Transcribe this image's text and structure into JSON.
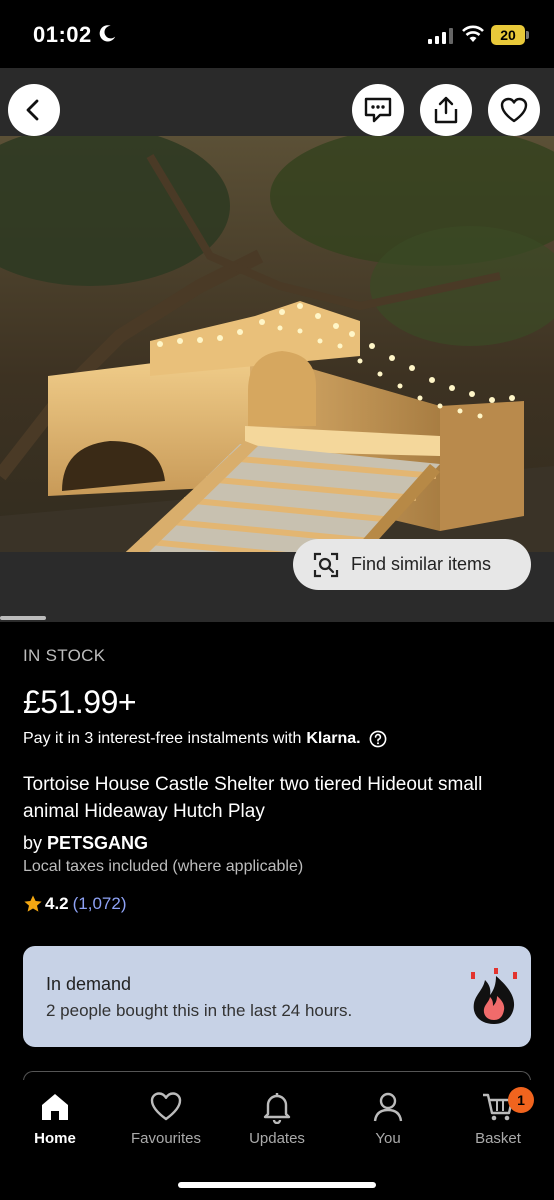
{
  "status_bar": {
    "time": "01:02",
    "battery": "20"
  },
  "hero": {
    "find_similar_label": "Find similar items",
    "icons": [
      "back-icon",
      "message-icon",
      "share-icon",
      "heart-icon"
    ]
  },
  "product": {
    "stock": "IN STOCK",
    "price": "£51.99+",
    "klarna_text": "Pay it in 3 interest-free instalments with",
    "klarna_brand": "Klarna.",
    "title": "Tortoise House Castle Shelter two tiered Hideout small animal Hideaway Hutch Play",
    "seller_prefix": "by",
    "seller": "PETSGANG",
    "taxes": "Local taxes included (where applicable)",
    "rating": "4.2",
    "review_count": "(1,072)"
  },
  "demand": {
    "title": "In demand",
    "text": "2 people bought this in the last 24 hours."
  },
  "tabs": [
    {
      "label": "Home",
      "icon": "home-icon"
    },
    {
      "label": "Favourites",
      "icon": "heart-icon"
    },
    {
      "label": "Updates",
      "icon": "bell-icon"
    },
    {
      "label": "You",
      "icon": "person-icon"
    },
    {
      "label": "Basket",
      "icon": "cart-icon"
    }
  ],
  "basket_badge": "1",
  "colors": {
    "background": "#000000",
    "demand_card": "#c7d2e6",
    "badge": "#f1641e",
    "review_link": "#8ea2f5",
    "flame_red": "#e3342f"
  }
}
